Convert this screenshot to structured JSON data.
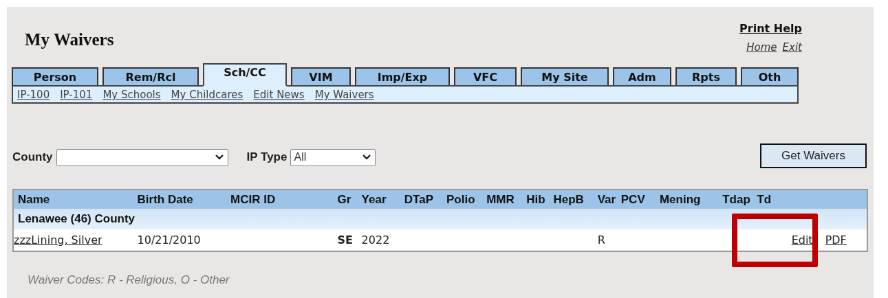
{
  "page": {
    "title": "My Waivers"
  },
  "header_links": {
    "print_help": "Print Help",
    "home": "Home",
    "exit": "Exit"
  },
  "tabs": [
    {
      "label": "Person",
      "selected": false
    },
    {
      "label": "Rem/Rcl",
      "selected": false
    },
    {
      "label": "Sch/CC",
      "selected": true
    },
    {
      "label": "VIM",
      "selected": false
    },
    {
      "label": "Imp/Exp",
      "selected": false
    },
    {
      "label": "VFC",
      "selected": false
    },
    {
      "label": "My Site",
      "selected": false
    },
    {
      "label": "Adm",
      "selected": false
    },
    {
      "label": "Rpts",
      "selected": false
    },
    {
      "label": "Oth",
      "selected": false
    }
  ],
  "subnav": [
    "IP-100",
    "IP-101",
    "My Schools",
    "My Childcares",
    "Edit News",
    "My Waivers"
  ],
  "filters": {
    "county_label": "County",
    "ip_type_label": "IP Type",
    "ip_type_value": "All",
    "button": "Get Waivers"
  },
  "table": {
    "columns": [
      "Name",
      "Birth Date",
      "MCIR ID",
      "Gr",
      "Year",
      "DTaP",
      "Polio",
      "MMR",
      "Hib",
      "HepB",
      "Var",
      "PCV",
      "Mening",
      "Tdap",
      "Td"
    ],
    "rows": [
      {
        "kind": "group",
        "label": "Lenawee (46) County"
      },
      {
        "kind": "record",
        "name": "zzzLining, Silver",
        "birth_date": "10/21/2010",
        "gr": "SE",
        "year": "2022",
        "var": "R",
        "edit": "Edit",
        "pdf": "PDF",
        "highlighted": true
      }
    ]
  },
  "footer": "Waiver Codes: R - Religious, O - Other"
}
